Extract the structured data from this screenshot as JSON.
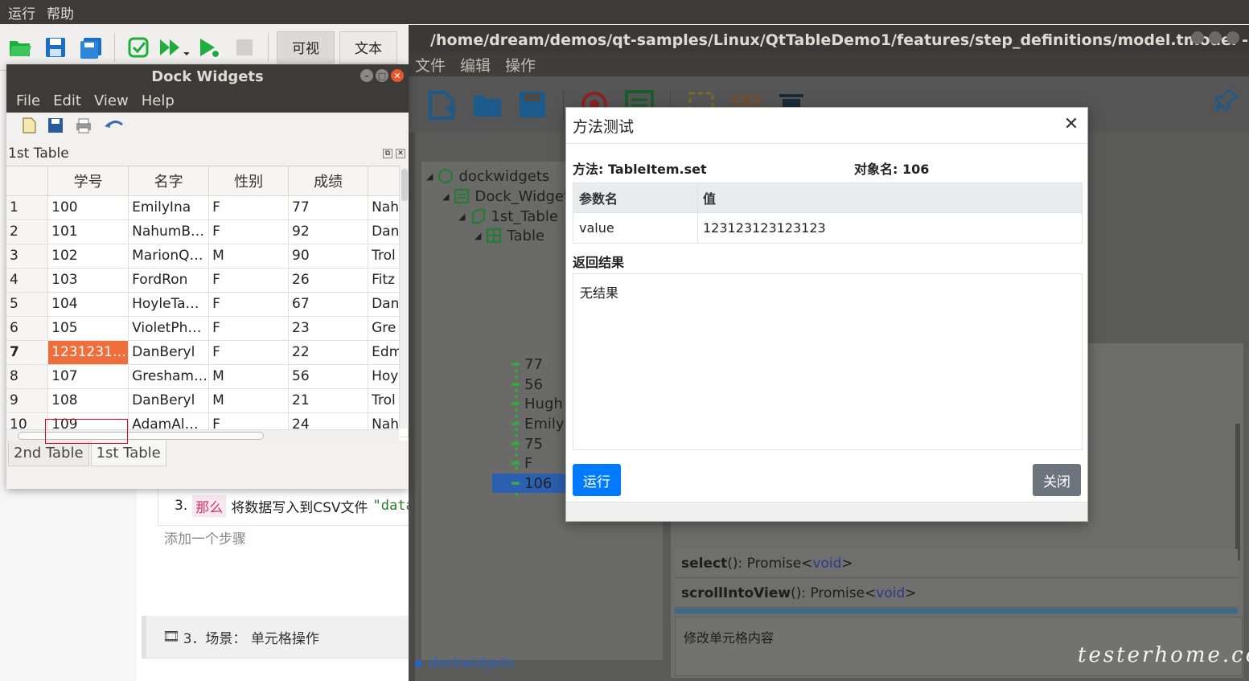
{
  "ide": {
    "menu": [
      "运行",
      "帮助"
    ],
    "modes": [
      "可视",
      "文本"
    ],
    "colors": {
      "green": "#1fae3c",
      "blue": "#1a6fc4"
    }
  },
  "doc": {
    "step3_num": "3.",
    "step3_keyword": "那么",
    "step3_text": "将数据写入到CSV文件",
    "step3_code": "\"data",
    "add_step": "添加一个步骤",
    "scene": "3．场景：  单元格操作"
  },
  "model_manager": {
    "title": "/home/dream/demos/qt-samples/Linux/QtTableDemo1/features/step_definitions/model.tmodel - 模型管理器",
    "menu": [
      "文件",
      "编辑",
      "操作"
    ],
    "tree": {
      "root": "dockwidgets",
      "dock": "Dock_Widget",
      "table1": "1st_Table",
      "table": "Table",
      "items": [
        "77",
        "56",
        "Hugh",
        "Emily",
        "75",
        "F",
        "106"
      ]
    },
    "methods": [
      {
        "name": "select",
        "sig": "():  Promise<",
        "type": "void",
        "end": ">"
      },
      {
        "name": "scrollIntoView",
        "sig": "():  Promise<",
        "type": "void",
        "end": ">"
      }
    ],
    "description": "修改单元格内容",
    "status": "dockwidgets",
    "watermark": "testerhome.com"
  },
  "dock": {
    "title": "Dock Widgets",
    "menu": [
      "File",
      "Edit",
      "View",
      "Help"
    ],
    "subtitle": "1st Table",
    "columns": [
      "学号",
      "名字",
      "性别",
      "成绩",
      ""
    ],
    "rows": [
      {
        "n": "1",
        "id": "100",
        "name": "EmilyIna",
        "sex": "F",
        "score": "77",
        "x": "Nah"
      },
      {
        "n": "2",
        "id": "101",
        "name": "NahumB…",
        "sex": "F",
        "score": "92",
        "x": "Dan"
      },
      {
        "n": "3",
        "id": "102",
        "name": "MarionQ…",
        "sex": "M",
        "score": "90",
        "x": "Trol"
      },
      {
        "n": "4",
        "id": "103",
        "name": "FordRon",
        "sex": "F",
        "score": "26",
        "x": "Fitz"
      },
      {
        "n": "5",
        "id": "104",
        "name": "HoyleTa…",
        "sex": "F",
        "score": "67",
        "x": "Dan"
      },
      {
        "n": "6",
        "id": "105",
        "name": "VioletPh…",
        "sex": "F",
        "score": "23",
        "x": "Gre"
      },
      {
        "n": "7",
        "id": "1231231…",
        "name": "DanBeryl",
        "sex": "F",
        "score": "22",
        "x": "Edm"
      },
      {
        "n": "8",
        "id": "107",
        "name": "Gresham…",
        "sex": "M",
        "score": "56",
        "x": "Hoy"
      },
      {
        "n": "9",
        "id": "108",
        "name": "DanBeryl",
        "sex": "M",
        "score": "21",
        "x": "Trol"
      },
      {
        "n": "10",
        "id": "109",
        "name": "AdamAl…",
        "sex": "F",
        "score": "24",
        "x": "Nah"
      }
    ],
    "tabs": [
      "2nd Table",
      "1st Table"
    ],
    "highlight_color": "#f06e3c"
  },
  "modal": {
    "title": "方法测试",
    "method_label": "方法: TableItem.set",
    "object_label": "对象名: 106",
    "param_header": "参数名",
    "value_header": "值",
    "param_name": "value",
    "param_value": "123123123123123",
    "result_label": "返回结果",
    "result_text": "无结果",
    "run": "运行",
    "close": "关闭",
    "colors": {
      "run": "#007bff",
      "close": "#6c757d"
    }
  }
}
